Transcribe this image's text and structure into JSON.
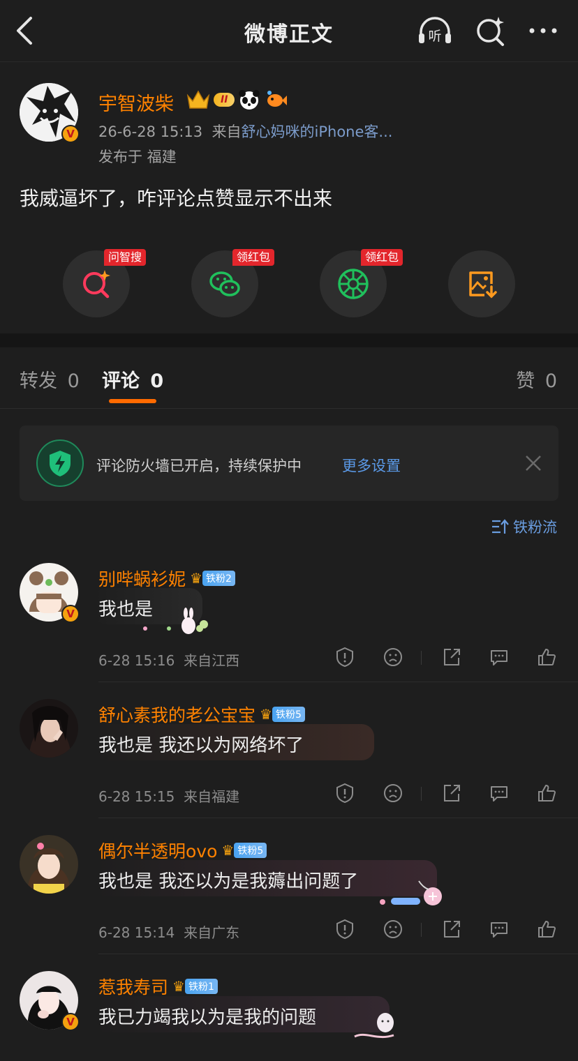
{
  "header": {
    "title": "微博正文",
    "listen_label": "听"
  },
  "post": {
    "username": "宇智波柴",
    "level_badge": "II",
    "verified_mark": "V",
    "time": "26-6-28 15:13",
    "source_prefix": "来自",
    "source_app": "舒心妈咪的iPhone客...",
    "location": "发布于 福建",
    "content": "我威逼坏了，咋评论点赞显示不出来"
  },
  "actions": [
    {
      "icon": "ai-search-icon",
      "tag": "问智搜",
      "color": "#ff3a5c"
    },
    {
      "icon": "wechat-icon",
      "tag": "领红包",
      "color": "#20c05c"
    },
    {
      "icon": "moments-icon",
      "tag": "领红包",
      "color": "#20c05c"
    },
    {
      "icon": "save-image-icon",
      "tag": "",
      "color": "#ff9a1f"
    }
  ],
  "tabs": {
    "repost": {
      "label": "转发",
      "count": "0"
    },
    "comment": {
      "label": "评论",
      "count": "0"
    },
    "like": {
      "label": "赞",
      "count": "0"
    }
  },
  "notice": {
    "text": "评论防火墙已开启，持续保护中",
    "link": "更多设置"
  },
  "sort_label": "铁粉流",
  "comments": [
    {
      "name": "别哔蜗衫妮",
      "fan_level": "铁粉2",
      "text": "我也是",
      "time": "6-28 15:16",
      "location": "来自江西",
      "verified": true
    },
    {
      "name": "舒心素我的老公宝宝",
      "fan_level": "铁粉5",
      "text": "我也是 我还以为网络坏了",
      "time": "6-28 15:15",
      "location": "来自福建",
      "verified": false
    },
    {
      "name": "偶尔半透明ovo",
      "fan_level": "铁粉5",
      "text": "我也是 我还以为是我薅出问题了",
      "time": "6-28 15:14",
      "location": "来自广东",
      "verified": false
    },
    {
      "name": "惹我寿司",
      "fan_level": "铁粉1",
      "text": "我已力竭我以为是我的问题",
      "time": "",
      "location": "",
      "verified": true
    }
  ],
  "colors": {
    "accent": "#ff8200",
    "tab_indicator": "#ff6a00",
    "link": "#5b9ae8",
    "background": "#1e1e1e"
  }
}
